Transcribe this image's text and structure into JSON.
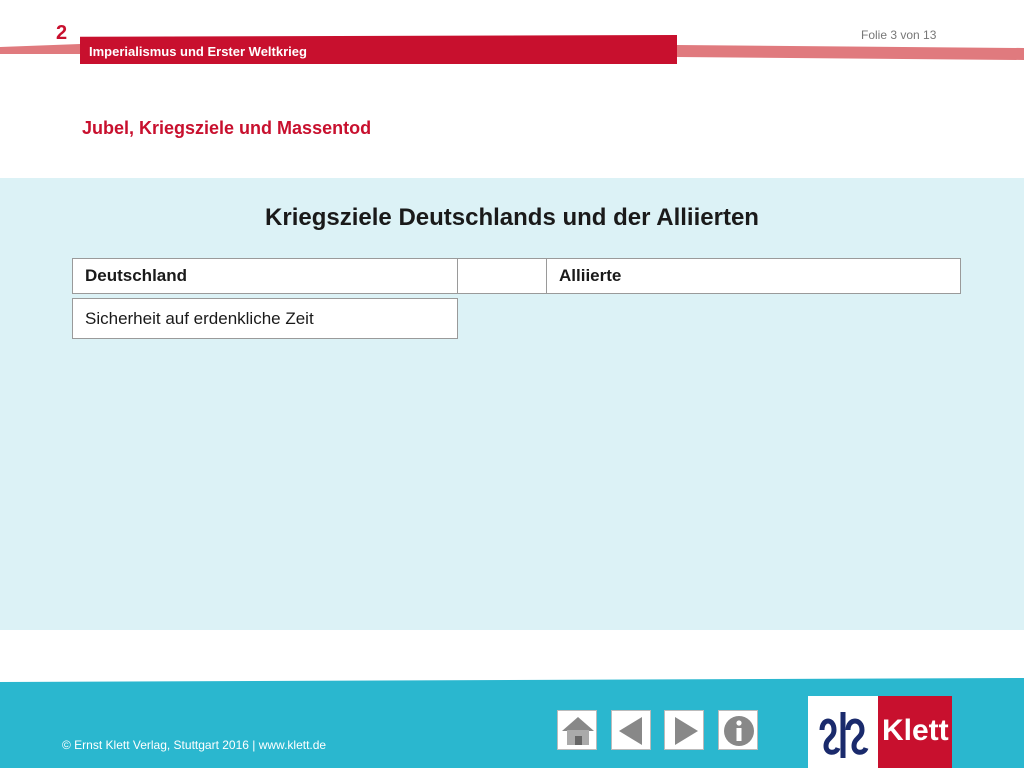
{
  "header": {
    "chapter_number": "2",
    "slide_counter": "Folie 3 von 13",
    "chapter_title": "Imperialismus und Erster Weltkrieg",
    "subtitle": "Jubel, Kriegsziele und Massentod"
  },
  "content": {
    "title": "Kriegsziele Deutschlands und der Alliierten",
    "table": {
      "headers": [
        "Deutschland",
        "",
        "Alliierte"
      ],
      "rows": [
        [
          "Sicherheit auf erdenkliche Zeit"
        ]
      ]
    }
  },
  "footer": {
    "copyright": "© Ernst Klett Verlag, Stuttgart 2016 | www.klett.de",
    "nav": [
      "home-icon",
      "arrow-left-icon",
      "arrow-right-icon",
      "info-icon"
    ],
    "logo_text": "Klett"
  },
  "colors": {
    "brand_red": "#c8102e",
    "content_bg": "#dcf2f6",
    "footer_bg": "#2ab7cf"
  }
}
